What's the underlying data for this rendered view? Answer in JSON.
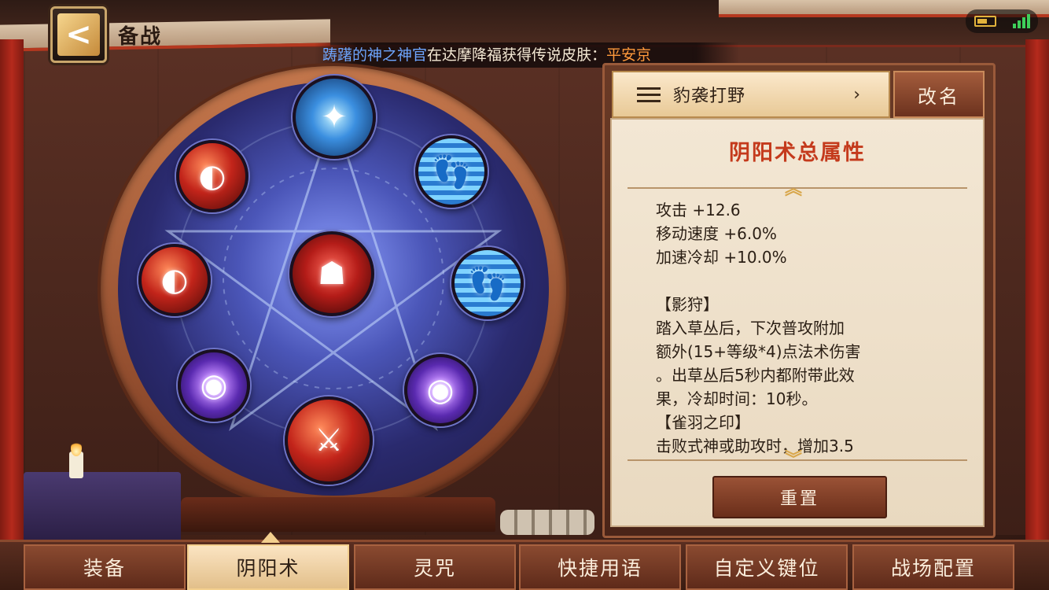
{
  "header": {
    "title": "备战",
    "back_label": "<"
  },
  "marquee": {
    "player_name": "踌躇的神之神官",
    "message": "在达摩降福获得传说皮肤：",
    "skin_name": "平安京"
  },
  "preset": {
    "name": "豹袭打野",
    "chevron": "›",
    "rename_label": "改名"
  },
  "panel": {
    "title": "阴阳术总属性",
    "up_arrow": "︽",
    "down_arrow": "︾",
    "stats": [
      "攻击 +12.6",
      "移动速度 +6.0%",
      "加速冷却 +10.0%"
    ],
    "effects": [
      "【影狩】",
      "踏入草丛后，下次普攻附加",
      "额外(15+等级*4)点法术伤害",
      "。出草丛后5秒内都附带此效",
      "果，冷却时间：10秒。",
      "【雀羽之印】",
      "击败式神或助攻时，增加3.5"
    ],
    "reset_label": "重置"
  },
  "runes": {
    "top": "bird-rune",
    "center": "beast-rune",
    "items": [
      "bird",
      "red",
      "red",
      "blue-boot",
      "blue-boot",
      "purple",
      "purple",
      "blade"
    ]
  },
  "tabs": [
    {
      "label": "装备",
      "active": false
    },
    {
      "label": "阴阳术",
      "active": true
    },
    {
      "label": "灵咒",
      "active": false
    },
    {
      "label": "快捷用语",
      "active": false
    },
    {
      "label": "自定义键位",
      "active": false
    },
    {
      "label": "战场配置",
      "active": false
    }
  ],
  "colors": {
    "accent_red": "#c43a1c",
    "player_blue": "#6ea6ff",
    "skin_orange": "#ff9a3c"
  }
}
